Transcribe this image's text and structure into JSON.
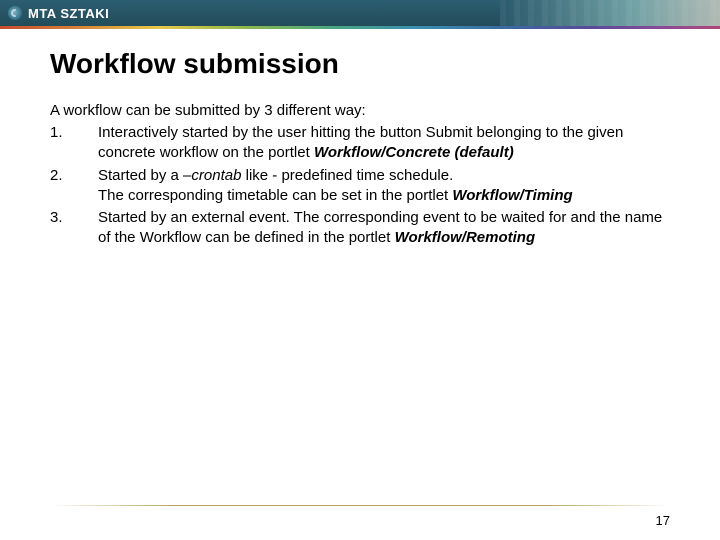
{
  "header": {
    "brand_text": "MTA SZTAKI"
  },
  "title": "Workflow submission",
  "intro": "A workflow can be submitted by 3 different way:",
  "items": [
    {
      "num": "1.",
      "pre": "Interactively started by the user hitting the button Submit belonging to the given concrete workflow  on the portlet ",
      "portlet": "Workflow/Concrete (default)",
      "post": ""
    },
    {
      "num": "2.",
      "pre": "Started by a –",
      "mid_italic": "crontab",
      "mid_plain": " like - predefined time schedule.",
      "line2": "The corresponding timetable can be set in the portlet ",
      "portlet": "Workflow/Timing",
      "post": ""
    },
    {
      "num": "3.",
      "pre": "Started by an external event. The corresponding event to be waited for and the name of the Workflow can be defined in the portlet ",
      "portlet": "Workflow/Remoting",
      "post": ""
    }
  ],
  "page_number": "17"
}
